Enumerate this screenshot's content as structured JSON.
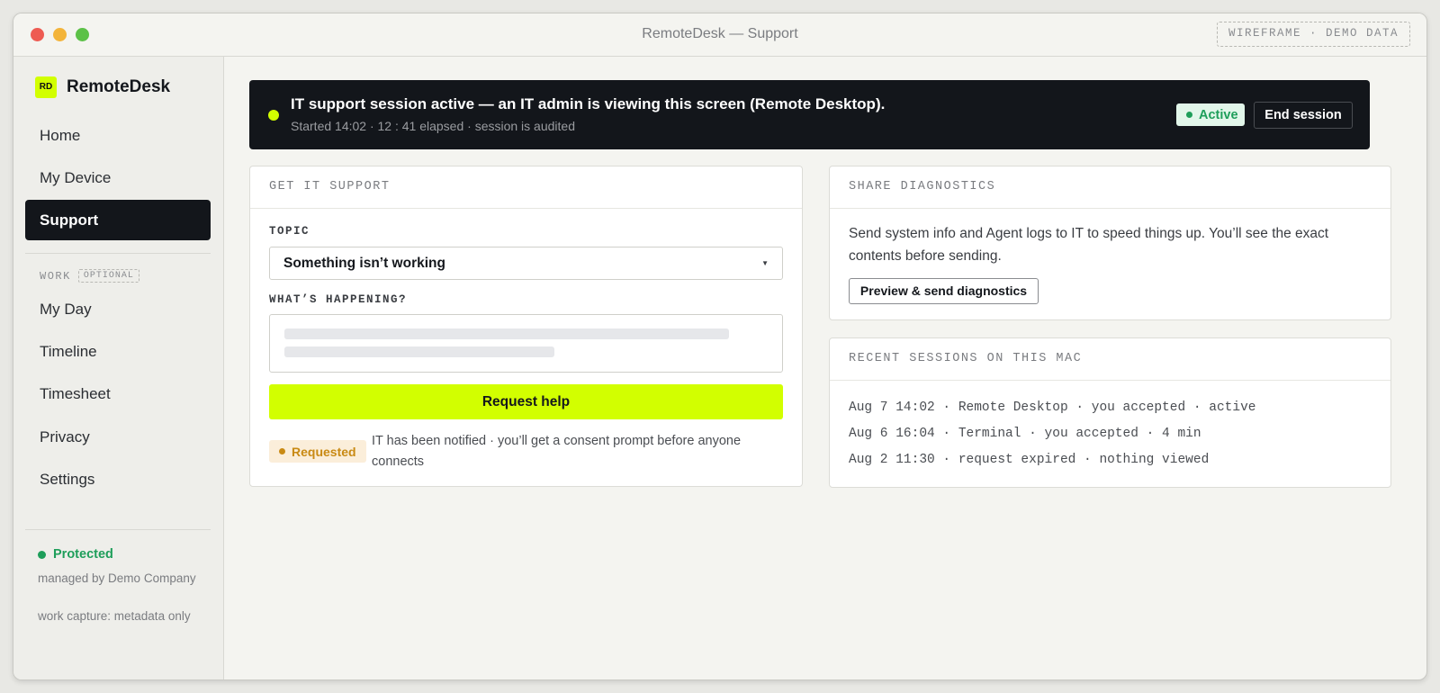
{
  "window": {
    "title": "RemoteDesk — Support",
    "tag": "WIREFRAME · DEMO DATA"
  },
  "sidebar": {
    "brand_logo": "RD",
    "brand_name": "RemoteDesk",
    "items": [
      {
        "label": "Home",
        "active": false
      },
      {
        "label": "My Device",
        "active": false
      },
      {
        "label": "Support",
        "active": true
      }
    ],
    "work_section": {
      "label": "WORK",
      "tag": "OPTIONAL",
      "items": [
        {
          "label": "My Day"
        },
        {
          "label": "Timeline"
        },
        {
          "label": "Timesheet"
        },
        {
          "label": "Privacy"
        },
        {
          "label": "Settings"
        }
      ]
    },
    "status": {
      "label": "Protected",
      "managed_by": "managed by Demo Company",
      "capture": "work capture: metadata only",
      "color": "#1e9e5a"
    }
  },
  "banner": {
    "title": "IT support session active — an IT admin is viewing this screen (Remote Desktop).",
    "subtitle": "Started 14:02 · 12 : 41 elapsed · session is audited",
    "badge": "Active",
    "end_button": "End session"
  },
  "support": {
    "heading": "GET IT SUPPORT",
    "topic_label": "TOPIC",
    "topic_value": "Something isn’t working",
    "caret": "▼",
    "happening_label": "WHAT’S HAPPENING?",
    "request_button": "Request help",
    "status_badge": "Requested",
    "status_note": "IT has been notified · you’ll get a consent prompt before anyone connects"
  },
  "diagnostics": {
    "heading": "SHARE DIAGNOSTICS",
    "text": "Send system info and Agent logs to IT to speed things up. You’ll see the exact contents before sending.",
    "button": "Preview & send diagnostics"
  },
  "sessions": {
    "heading": "RECENT SESSIONS ON THIS MAC",
    "items": [
      "Aug 7 14:02 · Remote Desktop · you accepted · active",
      "Aug 6 16:04 · Terminal · you accepted · 4 min",
      "Aug 2 11:30 · request expired · nothing viewed"
    ]
  },
  "colors": {
    "accent": "#d2ff00",
    "dark": "#13161b",
    "success": "#1e9e5a",
    "warning": "#c98a14"
  }
}
